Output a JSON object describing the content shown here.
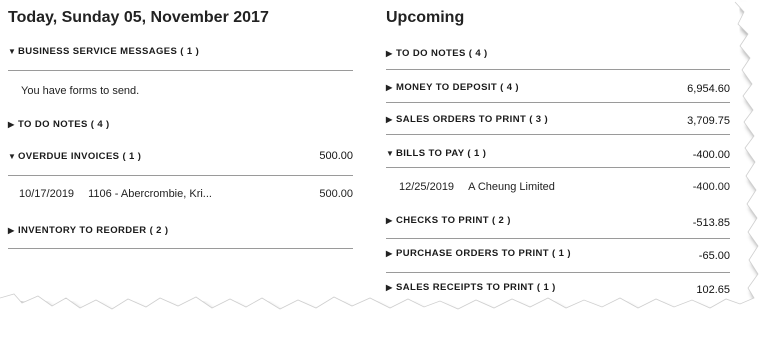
{
  "left": {
    "title": "Today, Sunday 05, November 2017",
    "sections": {
      "business_messages": {
        "label": "BUSINESS SERVICE MESSAGES ( 1 )",
        "message": "You have forms to send."
      },
      "todo": {
        "label": "TO DO NOTES ( 4 )"
      },
      "overdue": {
        "label": "OVERDUE INVOICES ( 1 )",
        "amount": "500.00",
        "row": {
          "date": "10/17/2019",
          "ref": "1106 - Abercrombie, Kri...",
          "amount": "500.00"
        }
      },
      "inventory": {
        "label": "INVENTORY TO REORDER ( 2 )"
      }
    }
  },
  "right": {
    "title": "Upcoming",
    "sections": {
      "todo": {
        "label": "TO DO NOTES ( 4 )"
      },
      "money_deposit": {
        "label": "MONEY TO DEPOSIT ( 4 )",
        "amount": "6,954.60"
      },
      "sales_orders": {
        "label": "SALES ORDERS TO PRINT ( 3 )",
        "amount": "3,709.75"
      },
      "bills": {
        "label": "BILLS TO PAY ( 1 )",
        "amount": "-400.00",
        "row": {
          "date": "12/25/2019",
          "vendor": "A Cheung Limited",
          "amount": "-400.00"
        }
      },
      "checks": {
        "label": "CHECKS TO PRINT ( 2 )",
        "amount": "-513.85"
      },
      "purchase_orders": {
        "label": "PURCHASE ORDERS TO PRINT ( 1 )",
        "amount": "-65.00"
      },
      "sales_receipts": {
        "label": "SALES RECEIPTS TO PRINT ( 1 )",
        "amount": "102.65"
      }
    }
  },
  "icons": {
    "collapsed": "▶",
    "expanded": "▼"
  }
}
